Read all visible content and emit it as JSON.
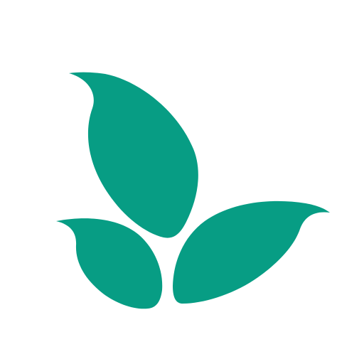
{
  "logo": {
    "icon": "three-leaves-icon",
    "colors": {
      "leaf": "#079d84",
      "background": "#ffffff"
    }
  }
}
